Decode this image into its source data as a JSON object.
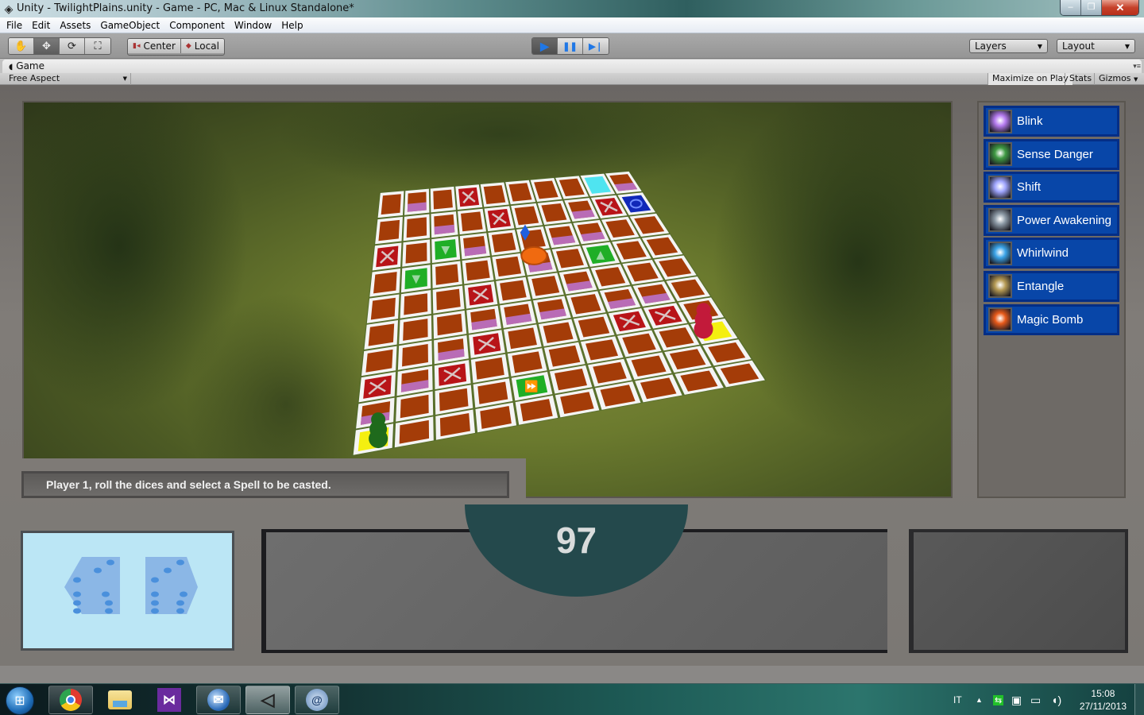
{
  "window": {
    "title": "Unity - TwilightPlains.unity - Game - PC, Mac & Linux Standalone*",
    "controls": {
      "minimize": "–",
      "maximize": "❐",
      "close": "✕"
    }
  },
  "menu": [
    "File",
    "Edit",
    "Assets",
    "GameObject",
    "Component",
    "Window",
    "Help"
  ],
  "toolbar": {
    "transform_tools": [
      {
        "name": "hand-tool",
        "glyph": "✋"
      },
      {
        "name": "move-tool",
        "glyph": "✥",
        "active": true
      },
      {
        "name": "rotate-tool",
        "glyph": "⟳"
      },
      {
        "name": "scale-tool",
        "glyph": "⛶"
      }
    ],
    "pivot": {
      "center_label": "Center",
      "local_label": "Local"
    },
    "play": {
      "play": "▶",
      "pause": "❚❚",
      "step": "▶❘",
      "playing": true
    },
    "layers_label": "Layers",
    "layout_label": "Layout"
  },
  "game_tab": {
    "title": "Game",
    "aspect": "Free Aspect",
    "maximize_on_play": "Maximize on Play",
    "stats": "Stats",
    "gizmos": "Gizmos"
  },
  "game": {
    "board": {
      "rows": 10,
      "cols": 10,
      "tiles": [
        [
          "brown",
          "fire",
          "brown",
          "x",
          "brown",
          "brown",
          "brown",
          "brown",
          "cyan",
          "fire"
        ],
        [
          "brown",
          "brown",
          "fire",
          "brown",
          "x",
          "brown",
          "brown",
          "fire",
          "x",
          "blue"
        ],
        [
          "x",
          "brown",
          "green-down",
          "fire",
          "brown",
          "brown",
          "fire",
          "fire",
          "brown",
          "brown"
        ],
        [
          "brown",
          "green-down",
          "brown",
          "brown",
          "brown",
          "fire",
          "brown",
          "green-up",
          "brown",
          "brown"
        ],
        [
          "brown",
          "brown",
          "brown",
          "x",
          "brown",
          "brown",
          "fire",
          "brown",
          "brown",
          "brown"
        ],
        [
          "brown",
          "brown",
          "brown",
          "fire",
          "fire",
          "fire",
          "brown",
          "fire",
          "fire",
          "brown"
        ],
        [
          "brown",
          "brown",
          "fire",
          "x",
          "brown",
          "brown",
          "brown",
          "x",
          "x",
          "brown"
        ],
        [
          "x",
          "fire",
          "x",
          "brown",
          "brown",
          "brown",
          "brown",
          "brown",
          "brown",
          "yellow"
        ],
        [
          "fire",
          "brown",
          "brown",
          "brown",
          "green-ff",
          "brown",
          "brown",
          "brown",
          "brown",
          "brown"
        ],
        [
          "yellow",
          "brown",
          "brown",
          "brown",
          "brown",
          "brown",
          "brown",
          "brown",
          "brown",
          "brown"
        ]
      ],
      "tile_colors": {
        "brown": "#a43c08",
        "x": "#b81418",
        "green": "#1fae26",
        "blue": "#1028b8",
        "cyan": "#4fe4f0",
        "yellow": "#f4ef10",
        "fire": "#a043a8"
      }
    },
    "spells": [
      {
        "label": "Blink",
        "icon": "blink-icon",
        "color": "#b67cf0"
      },
      {
        "label": "Sense Danger",
        "icon": "sense-danger-icon",
        "color": "#3f9a43"
      },
      {
        "label": "Shift",
        "icon": "shift-icon",
        "color": "#a0a6ff"
      },
      {
        "label": "Power Awakening",
        "icon": "power-awakening-icon",
        "color": "#8d9aa6"
      },
      {
        "label": "Whirlwind",
        "icon": "whirlwind-icon",
        "color": "#3ba4e8"
      },
      {
        "label": "Entangle",
        "icon": "entangle-icon",
        "color": "#b59a54"
      },
      {
        "label": "Magic Bomb",
        "icon": "magic-bomb-icon",
        "color": "#e85a1a"
      }
    ],
    "message": "Player 1, roll the dices and select a Spell to be casted.",
    "counter": "97",
    "dice": [
      {
        "face": 6
      },
      {
        "face": 6
      }
    ]
  },
  "taskbar": {
    "apps": [
      "chrome-icon",
      "explorer-icon",
      "visual-studio-icon",
      "thunderbird-icon",
      "unity-icon",
      "remote-desktop-icon"
    ],
    "language": "IT",
    "time": "15:08",
    "date": "27/11/2013"
  }
}
